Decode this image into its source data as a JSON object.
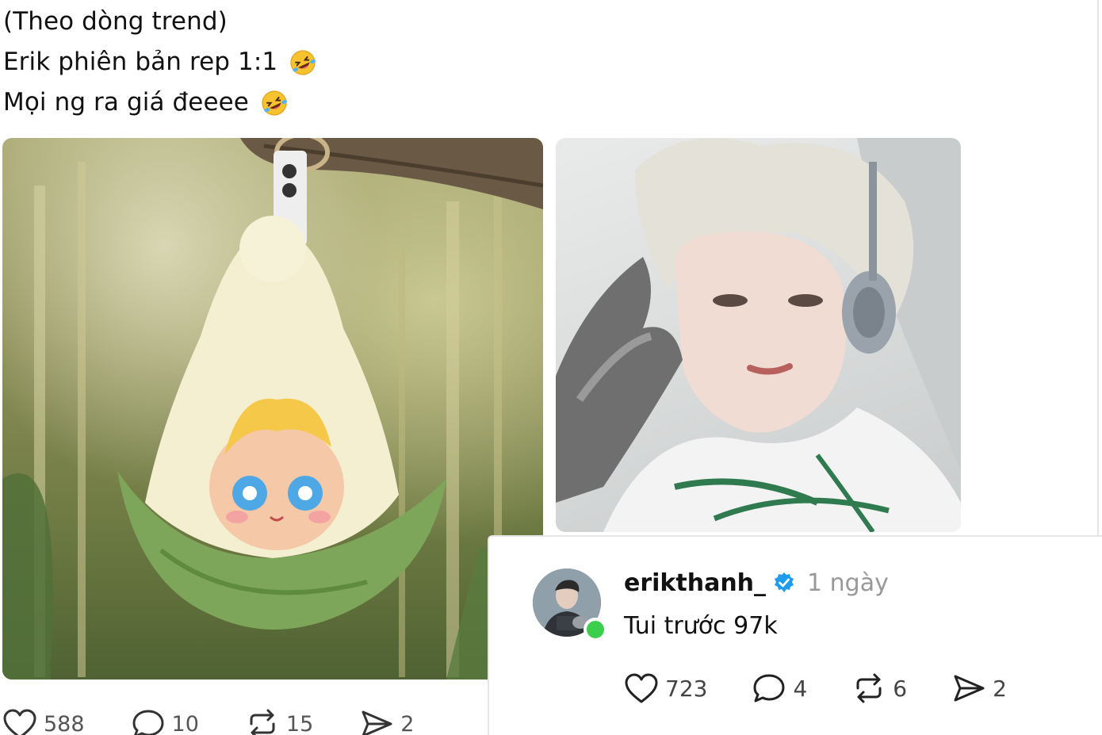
{
  "post": {
    "caption_lines": [
      {
        "text": "(Theo dòng trend)",
        "emoji": ""
      },
      {
        "text": "Erik phiên bản rep 1:1",
        "emoji": "rolling-on-floor-laughing-emoji"
      },
      {
        "text": "Mọi ng ra giá đeeee",
        "emoji": "rolling-on-floor-laughing-emoji"
      }
    ],
    "images": [
      {
        "name": "plush-keychain-photo",
        "description_icon": "image"
      },
      {
        "name": "singer-photo",
        "description_icon": "image"
      }
    ],
    "actions": {
      "likes": "588",
      "comments": "10",
      "reposts": "15",
      "shares": "2"
    }
  },
  "reply": {
    "username": "erikthanh_",
    "verified": true,
    "time": "1 ngày",
    "text": "Tui trước 97k",
    "online": true,
    "actions": {
      "likes": "723",
      "comments": "4",
      "reposts": "6",
      "shares": "2"
    }
  },
  "colors": {
    "verified_blue": "#1d9bf0",
    "online_green": "#3ccf4e",
    "muted_text": "#999999"
  }
}
